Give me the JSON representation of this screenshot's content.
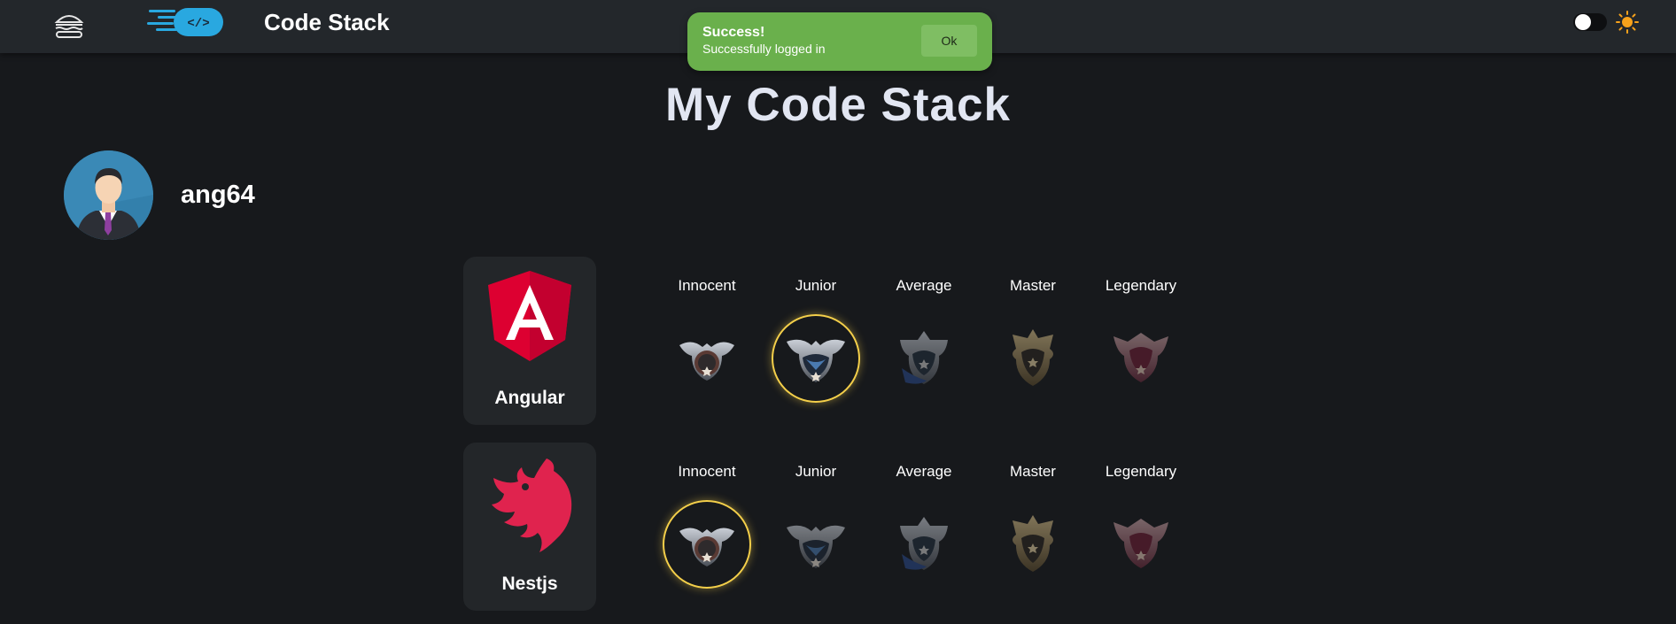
{
  "header": {
    "app_title": "Code Stack",
    "menu_icon": "burger-icon",
    "logo_icon": "code-brackets-logo",
    "theme": {
      "moon_icon": "moon-icon",
      "sun_icon": "sun-icon",
      "dark_mode": false
    }
  },
  "toast": {
    "title": "Success!",
    "message": "Successfully logged in",
    "ok_label": "Ok",
    "color": "#6ab04c"
  },
  "page_title": "My Code Stack",
  "profile": {
    "username": "ang64",
    "avatar_icon": "user-avatar"
  },
  "stack": [
    {
      "name": "Angular",
      "logo": "angular-logo",
      "levels": [
        {
          "label": "Innocent",
          "icon": "innocent-badge-icon"
        },
        {
          "label": "Junior",
          "icon": "junior-badge-icon"
        },
        {
          "label": "Average",
          "icon": "average-badge-icon"
        },
        {
          "label": "Master",
          "icon": "master-badge-icon"
        },
        {
          "label": "Legendary",
          "icon": "legendary-badge-icon"
        }
      ],
      "selected_level": "Junior"
    },
    {
      "name": "Nestjs",
      "logo": "nestjs-logo",
      "levels": [
        {
          "label": "Innocent",
          "icon": "innocent-badge-icon"
        },
        {
          "label": "Junior",
          "icon": "junior-badge-icon"
        },
        {
          "label": "Average",
          "icon": "average-badge-icon"
        },
        {
          "label": "Master",
          "icon": "master-badge-icon"
        },
        {
          "label": "Legendary",
          "icon": "legendary-badge-icon"
        }
      ],
      "selected_level": "Innocent"
    }
  ],
  "colors": {
    "background": "#17191c",
    "header": "#23272b",
    "card": "#232629",
    "selected_ring": "#f4cf4a",
    "angular_red": "#dd0031",
    "nest_red": "#e0234e",
    "logo_blue": "#29a8e0"
  }
}
